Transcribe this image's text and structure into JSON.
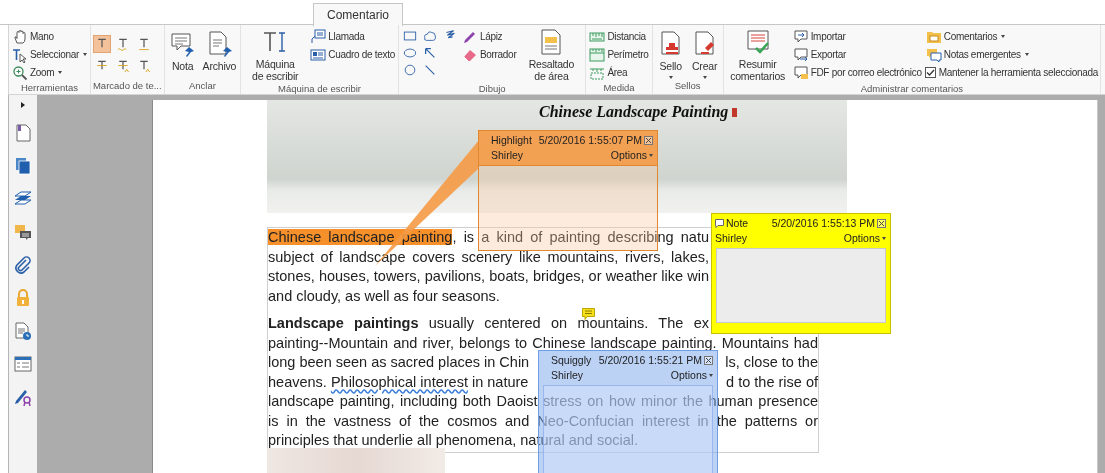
{
  "tabs": [
    {
      "label": "Comentario",
      "selected": true
    }
  ],
  "ribbon": {
    "groups": [
      {
        "label": "Herramientas",
        "items": [
          {
            "kind": "small",
            "label": "Mano",
            "dropdown": false
          },
          {
            "kind": "small",
            "label": "Seleccionar",
            "dropdown": true
          },
          {
            "kind": "small",
            "label": "Zoom",
            "dropdown": true
          }
        ]
      },
      {
        "label": "Marcado de te...",
        "items": [
          {
            "kind": "tool",
            "selected": true
          },
          {
            "kind": "tool",
            "selected": false
          },
          {
            "kind": "tool",
            "selected": false
          },
          {
            "kind": "tool",
            "selected": false
          },
          {
            "kind": "tool",
            "selected": false
          },
          {
            "kind": "tool",
            "selected": false
          }
        ]
      },
      {
        "label": "Anclar",
        "items": [
          {
            "kind": "large",
            "label": "Nota",
            "dropdown": false
          },
          {
            "kind": "large",
            "label": "Archivo",
            "dropdown": false
          }
        ]
      },
      {
        "label": "Máquina de escribir",
        "items": [
          {
            "kind": "large",
            "label": "Máquina de escribir",
            "dropdown": false
          },
          {
            "kind": "small",
            "label": "Llamada",
            "dropdown": false
          },
          {
            "kind": "small",
            "label": "Cuadro de texto",
            "dropdown": false
          }
        ]
      },
      {
        "label": "Dibujo",
        "items": [
          {
            "kind": "tool",
            "selected": false
          },
          {
            "kind": "tool",
            "selected": false
          },
          {
            "kind": "tool",
            "selected": false
          },
          {
            "kind": "tool",
            "selected": false
          },
          {
            "kind": "tool",
            "selected": false
          },
          {
            "kind": "tool",
            "selected": false
          },
          {
            "kind": "tool",
            "selected": false
          },
          {
            "kind": "small",
            "label": "Lápiz",
            "dropdown": false
          },
          {
            "kind": "small",
            "label": "Borrador",
            "dropdown": false
          },
          {
            "kind": "large",
            "label": "Resaltado de área",
            "dropdown": false
          }
        ]
      },
      {
        "label": "Medida",
        "items": [
          {
            "kind": "small",
            "label": "Distancia",
            "dropdown": false
          },
          {
            "kind": "small",
            "label": "Perímetro",
            "dropdown": false
          },
          {
            "kind": "small",
            "label": "Área",
            "dropdown": false
          }
        ]
      },
      {
        "label": "Sellos",
        "items": [
          {
            "kind": "large",
            "label": "Sello",
            "dropdown": true
          },
          {
            "kind": "large",
            "label": "Crear",
            "dropdown": true
          }
        ]
      },
      {
        "label": "Administrar comentarios",
        "items": [
          {
            "kind": "large",
            "label": "Resumir comentarios",
            "dropdown": false
          },
          {
            "kind": "small",
            "label": "Importar",
            "dropdown": false
          },
          {
            "kind": "small",
            "label": "Exportar",
            "dropdown": false
          },
          {
            "kind": "small",
            "label": "FDF por correo electrónico",
            "dropdown": false
          },
          {
            "kind": "small",
            "label": "Comentarios",
            "dropdown": true
          },
          {
            "kind": "small",
            "label": "Notas emergentes",
            "dropdown": true
          },
          {
            "kind": "check",
            "label": "Mantener la herramienta seleccionada",
            "checked": true
          }
        ]
      }
    ]
  },
  "document": {
    "banner_title": "Chinese Landscape Painting",
    "paragraphs": [
      {
        "lines": [
          {
            "spans": [
              {
                "kind": "highlight",
                "text": "Chinese landscape painting"
              },
              {
                "kind": "plain",
                "text": ", is a kind of painting describing natu"
              }
            ]
          },
          {
            "spans": [
              {
                "kind": "plain",
                "text": "subject of landscape covers scenery like mountains, rivers, lakes,"
              }
            ]
          },
          {
            "spans": [
              {
                "kind": "plain",
                "text": "stones, houses, towers, pavilions, boats, bridges, or weather like win"
              }
            ]
          },
          {
            "spans": [
              {
                "kind": "plain",
                "text": "and cloudy, as well as four seasons."
              }
            ]
          }
        ]
      },
      {
        "lines": [
          {
            "spans": [
              {
                "kind": "bold",
                "text": "Landscape paintings"
              },
              {
                "kind": "plain",
                "text": " usually centered on mountains. The ex"
              }
            ]
          },
          {
            "spans": [
              {
                "kind": "plain",
                "text": "painting--Mountain and river, belongs to Chinese landscape painting. Mountains had"
              }
            ]
          },
          {
            "spans": [
              {
                "kind": "plain",
                "text": "long been seen as sacred places in Chin"
              },
              {
                "kind": "gap"
              },
              {
                "kind": "plain",
                "text": "ls, close to the"
              }
            ]
          },
          {
            "spans": [
              {
                "kind": "plain",
                "text": "heavens. "
              },
              {
                "kind": "squiggly",
                "text": "Philosophical interest"
              },
              {
                "kind": "plain",
                "text": " in nature"
              },
              {
                "kind": "gap"
              },
              {
                "kind": "plain",
                "text": "d to the rise of"
              }
            ]
          },
          {
            "spans": [
              {
                "kind": "plain",
                "text": "landscape painting, including both Daoist stress on how minor the human presence"
              }
            ]
          },
          {
            "spans": [
              {
                "kind": "plain",
                "text": "is in the vastness of the cosmos and Neo-Confucian interest in the patterns or"
              }
            ]
          },
          {
            "spans": [
              {
                "kind": "plain",
                "text": "principles that underlie all phenomena, natural and social."
              }
            ]
          }
        ]
      }
    ]
  },
  "popups": [
    {
      "kind": "highlight",
      "title": "Highlight",
      "date": "5/20/2016 1:55:07 PM",
      "author": "Shirley",
      "options": "Options"
    },
    {
      "kind": "note",
      "title": "Note",
      "date": "5/20/2016 1:55:13 PM",
      "author": "Shirley",
      "options": "Options"
    },
    {
      "kind": "squiggly",
      "title": "Squiggly",
      "date": "5/20/2016 1:55:21 PM",
      "author": "Shirley",
      "options": "Options"
    }
  ]
}
